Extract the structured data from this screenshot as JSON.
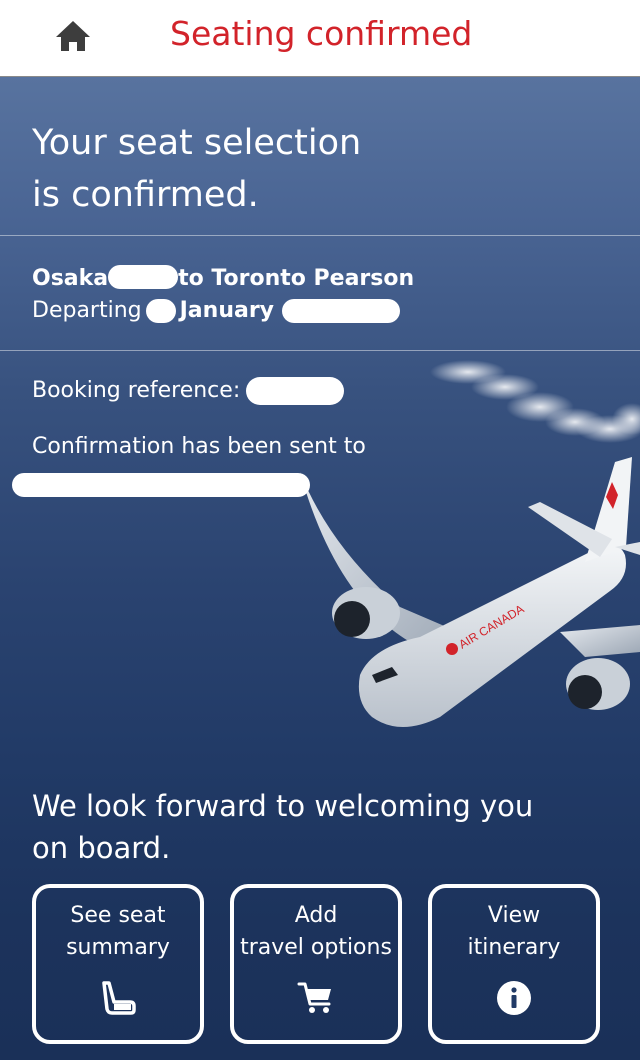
{
  "header": {
    "home_icon": "home-icon",
    "title": "Seating confirmed",
    "title_color": "#d2232a"
  },
  "confirmation": {
    "headline_line1": "Your seat selection",
    "headline_line2": "is confirmed.",
    "origin": "Osaka",
    "to_text": "to Toronto Pearson",
    "departing_label": "Departing",
    "month": "January",
    "booking_label": "Booking reference:",
    "sent_text": "Confirmation has been sent to"
  },
  "aircraft_livery": "AIR CANADA",
  "welcome": {
    "line1": "We look forward to welcoming you",
    "line2": "on board."
  },
  "actions": [
    {
      "line1": "See seat",
      "line2": "summary",
      "icon": "seat-icon"
    },
    {
      "line1": "Add",
      "line2": "travel options",
      "icon": "shopping-cart-icon"
    },
    {
      "line1": "View",
      "line2": "itinerary",
      "icon": "info-icon"
    }
  ]
}
